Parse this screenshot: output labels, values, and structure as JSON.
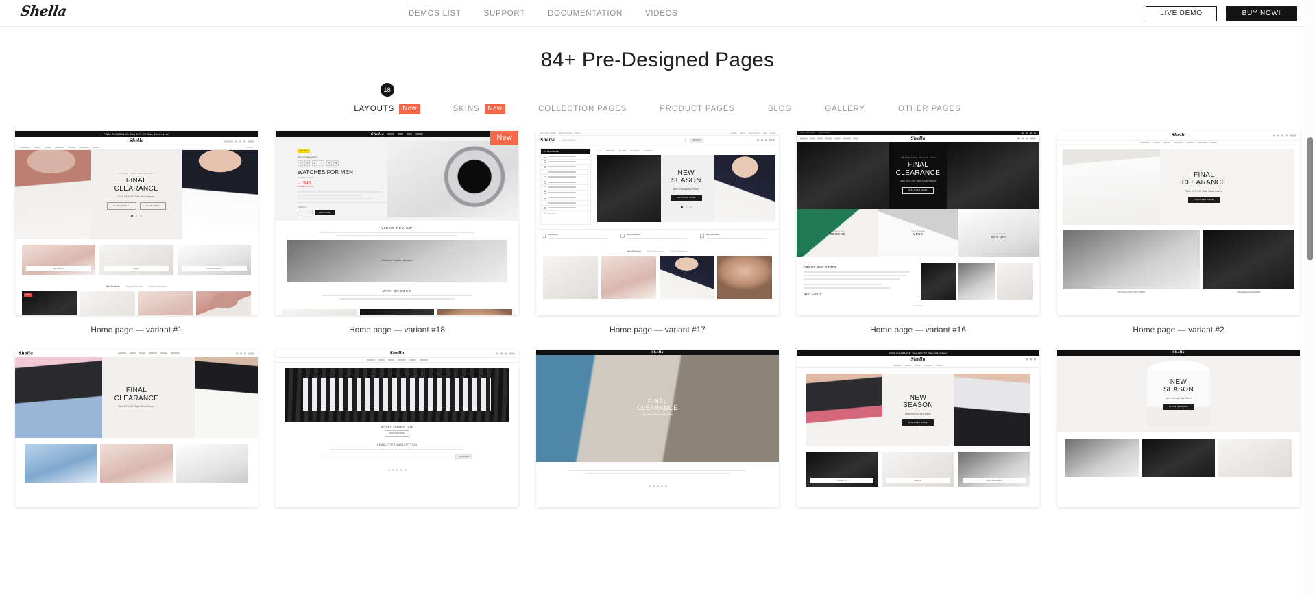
{
  "header": {
    "logo": "Shella",
    "nav": [
      {
        "label": "DEMOS LIST"
      },
      {
        "label": "SUPPORT"
      },
      {
        "label": "DOCUMENTATION"
      },
      {
        "label": "VIDEOS"
      }
    ],
    "live_demo_label": "LIVE DEMO",
    "buy_now_label": "BUY NOW!"
  },
  "page": {
    "title": "84+ Pre-Designed Pages"
  },
  "tabs": [
    {
      "label": "LAYOUTS",
      "badge": "New",
      "count": "18",
      "active": true
    },
    {
      "label": "SKINS",
      "badge": "New",
      "active": false
    },
    {
      "label": "COLLECTION PAGES",
      "active": false
    },
    {
      "label": "PRODUCT PAGES",
      "active": false
    },
    {
      "label": "BLOG",
      "active": false
    },
    {
      "label": "GALLERY",
      "active": false
    },
    {
      "label": "OTHER PAGES",
      "active": false
    }
  ],
  "cards": [
    {
      "caption": "Home page — variant #1",
      "corner_badge": "",
      "announce": "FINAL CLEARANCE: Take 20% Off 'Sale Must-Haves'",
      "hero_eyebrow": "LIMITED TIME. ONLINE ONLY",
      "hero_line1": "FINAL",
      "hero_line2": "CLEARANCE",
      "hero_sub": "Take 20% Off 'Sale Must-Haves'",
      "btn1": "SHOP WOMENS",
      "btn2": "SHOP MENS",
      "tiles": [
        "WOMENS",
        "MENS",
        "ACCESSORIES"
      ],
      "subtabs": [
        "New Products",
        "Special Products",
        "Featured Products"
      ],
      "sale_tag": "SALE",
      "search_label": "SEARCH"
    },
    {
      "caption": "Home page — variant #18",
      "corner_badge": "New",
      "deal_tag": "Hot Deal",
      "countdown_label": "Hurry up! Sales ends in:",
      "countdown": [
        "0",
        "5",
        "2",
        "4",
        "5",
        "8",
        "2",
        "1"
      ],
      "product_title": "WATCHES FOR MEN",
      "product_sub": "Availability: In Stock",
      "price_old": "$50",
      "price": "$45",
      "price_note": "You Save $5.00 (10%)",
      "qty_label": "QUANTITY:",
      "add_to_cart": "ADD TO CART",
      "section1": "VIDEO REVIEW",
      "section2": "WHY CHOOSE",
      "video_caption": "Welcome Shopify merchant"
    },
    {
      "caption": "Home page — variant #17",
      "corner_badge": "",
      "topbar_phone": "Call Us: 800-123-4567",
      "topbar_hours": "Mon-Sun 9:00 a.m. - 6:00 p.m.",
      "account": [
        "Register",
        "Sign In",
        "Order Services",
        "USD",
        "English"
      ],
      "search_placeholder": "Search products...",
      "search_btn": "SEARCH",
      "cart": "$45.00",
      "categories_head": "CATEGORIES",
      "categories": [
        "WOMENS",
        "MENS",
        "LAYOUTS",
        "SHOP",
        "BLOG",
        "GALLERY",
        "PAGES",
        "VIDEOS",
        "DOCUMENTATION",
        "SUPPORT SYSTEM",
        "BUY THEME"
      ],
      "categories_more": "See all categories...",
      "menu": [
        "SHOP",
        "DELIVERY",
        "RETURN",
        "PAYMENTS",
        "CONTACTS"
      ],
      "hero_line1": "NEW",
      "hero_line2": "SEASON",
      "hero_sub": "New Arrivals Are Here!",
      "hero_btn": "DISCOVER MORE",
      "features": [
        "Free Shipping",
        "Payment Methods",
        "Returns worldwide"
      ],
      "subtabs": [
        "New Products",
        "Special Products",
        "Featured Products"
      ]
    },
    {
      "caption": "Home page — variant #16",
      "corner_badge": "",
      "topbar_phone": "Call us: 800-123-4567",
      "topbar_mail": "Send us an email",
      "hero_eyebrow": "LIMITED TIME. ONLINE ONLY",
      "hero_line1": "FINAL",
      "hero_line2": "CLEARANCE",
      "hero_sub": "Take 20% Off 'Sale Must-Haves'",
      "hero_btn": "DISCOVER MORE",
      "tiles_eyebrow": "COLLECTION 2019",
      "tiles": [
        "WOMENS",
        "MENS",
        "50% OFF"
      ],
      "about_eyebrow": "WELCOME",
      "about_title": "ABOUT OUR STORE",
      "about_link": "Our Products"
    },
    {
      "caption": "Home page — variant #2",
      "corner_badge": "",
      "hero_line1": "FINAL",
      "hero_line2": "CLEARANCE",
      "hero_sub": "Take 20% Off 'Sale Must-Haves'",
      "hero_btn": "DISCOVER MORE",
      "banner1": "40% OFF ALL PANTS AND T-SHIRTS",
      "banner2": "NEW-SEASON ACCESSORIES"
    },
    {
      "caption": "",
      "corner_badge": "",
      "hero_line1": "FINAL",
      "hero_line2": "CLEARANCE",
      "hero_sub": "Take 20% Off 'Sale Must-Haves'"
    },
    {
      "caption": "",
      "corner_badge": "",
      "hero_sub": "SPRING SUMMER 2019",
      "hero_btn": "DISCOVER MORE",
      "newsletter_title": "NEWSLETTER SUBSCRIPTION",
      "newsletter_btn": "SUBSCRIBE"
    },
    {
      "caption": "",
      "corner_badge": "",
      "hero_line1": "FINAL",
      "hero_line2": "CLEARANCE",
      "hero_sub": "Take 20% Off 'Sale Must-Haves'"
    },
    {
      "caption": "",
      "corner_badge": "",
      "announce": "FINAL CLEARANCE: Take 20% Off 'Sale Must-Haves'",
      "hero_line1": "NEW",
      "hero_line2": "SEASON",
      "hero_sub": "New Arrivals Are Here!",
      "hero_btn": "DISCOVER MORE",
      "tiles": [
        "T-SHIRTS",
        "JEANS",
        "ACCESSORIES"
      ]
    },
    {
      "caption": "",
      "corner_badge": "",
      "hero_line1": "NEW",
      "hero_line2": "SEASON",
      "hero_sub": "New Arrivals Are Here!",
      "hero_btn": "DISCOVER MORE"
    }
  ],
  "colors": {
    "accent": "#f4684a",
    "dark": "#131313",
    "muted": "#8f8f93"
  }
}
